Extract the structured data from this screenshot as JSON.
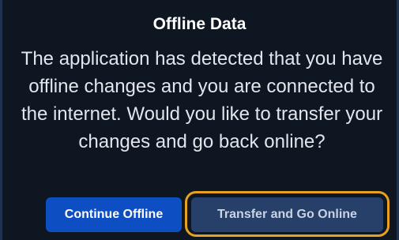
{
  "dialog": {
    "title": "Offline Data",
    "message": "The application has detected that you have offline changes and you are connected to the internet. Would you like to transfer your changes and go back online?",
    "buttons": {
      "continue_offline": "Continue Offline",
      "transfer_online": "Transfer and Go Online"
    }
  },
  "colors": {
    "background": "#0e1622",
    "primary_button": "#0d4ec2",
    "secondary_button": "#27406a",
    "focus_ring": "#e5a11f"
  }
}
